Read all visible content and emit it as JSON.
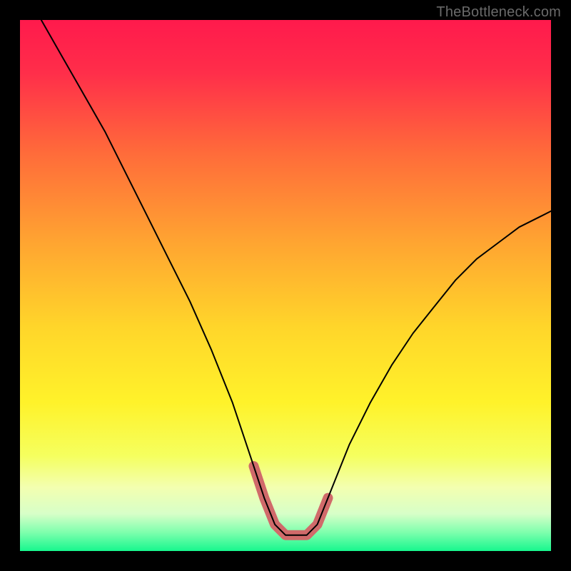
{
  "watermark": "TheBottleneck.com",
  "colors": {
    "frame": "#000000",
    "gradient_stops": [
      {
        "offset": 0.0,
        "color": "#ff1a4c"
      },
      {
        "offset": 0.1,
        "color": "#ff2e4a"
      },
      {
        "offset": 0.25,
        "color": "#ff6b3a"
      },
      {
        "offset": 0.42,
        "color": "#ffa531"
      },
      {
        "offset": 0.58,
        "color": "#ffd62a"
      },
      {
        "offset": 0.72,
        "color": "#fff22a"
      },
      {
        "offset": 0.82,
        "color": "#f5ff5e"
      },
      {
        "offset": 0.88,
        "color": "#f3ffb0"
      },
      {
        "offset": 0.93,
        "color": "#d7ffc8"
      },
      {
        "offset": 0.965,
        "color": "#7effad"
      },
      {
        "offset": 1.0,
        "color": "#17f78e"
      }
    ],
    "curve_stroke": "#000000",
    "trough_highlight": "#d06a6a"
  },
  "chart_data": {
    "type": "line",
    "title": "",
    "xlabel": "",
    "ylabel": "",
    "xlim": [
      0,
      100
    ],
    "ylim": [
      0,
      100
    ],
    "series": [
      {
        "name": "bottleneck-curve",
        "x": [
          4,
          8,
          12,
          16,
          20,
          24,
          28,
          32,
          36,
          40,
          42,
          44,
          46,
          48,
          50,
          52,
          54,
          56,
          58,
          62,
          66,
          70,
          74,
          78,
          82,
          86,
          90,
          94,
          98,
          100
        ],
        "y": [
          100,
          93,
          86,
          79,
          71,
          63,
          55,
          47,
          38,
          28,
          22,
          16,
          10,
          5,
          3,
          3,
          3,
          5,
          10,
          20,
          28,
          35,
          41,
          46,
          51,
          55,
          58,
          61,
          63,
          64
        ]
      }
    ],
    "trough_highlight": {
      "x": [
        44,
        46,
        48,
        50,
        52,
        54,
        56,
        58
      ],
      "y": [
        16,
        10,
        5,
        3,
        3,
        3,
        5,
        10
      ]
    }
  }
}
